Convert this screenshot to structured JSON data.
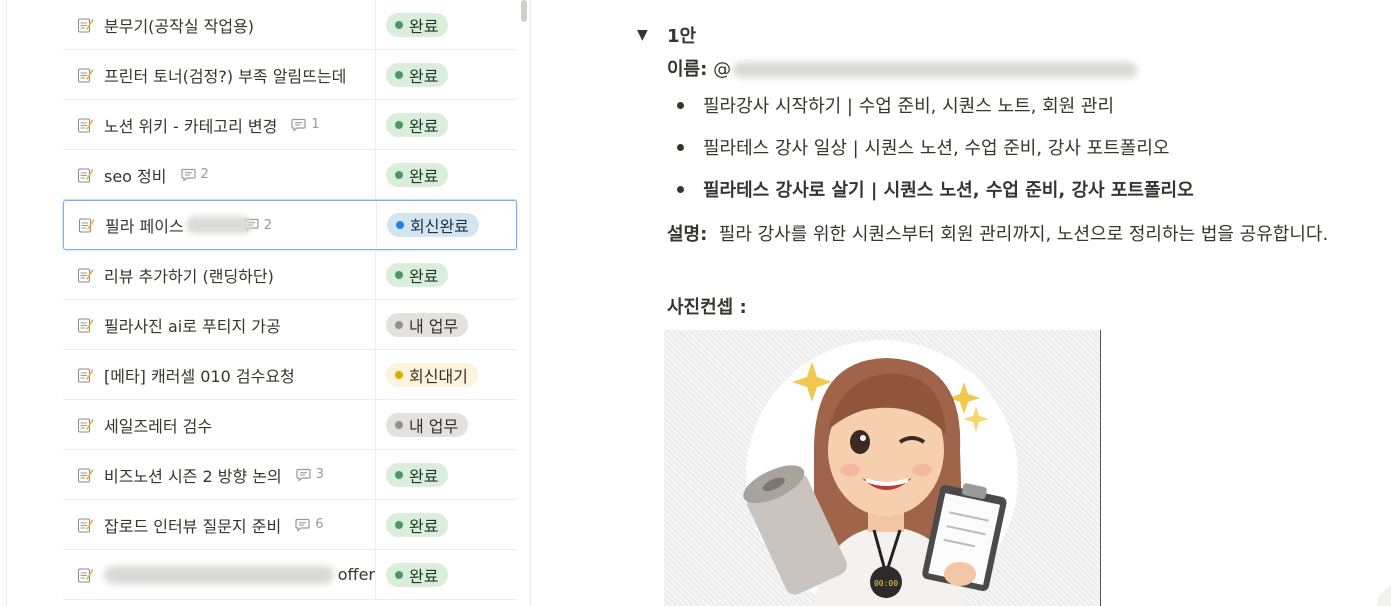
{
  "table": {
    "rows": [
      {
        "title": "분무기(공작실 작업용)",
        "comments": "",
        "status": "완료",
        "status_color": "green"
      },
      {
        "title": "프린터 토너(검정?) 부족 알림뜨는데",
        "comments": "",
        "status": "완료",
        "status_color": "green"
      },
      {
        "title": "노션 위키 - 카테고리 변경",
        "comments": "1",
        "status": "완료",
        "status_color": "green"
      },
      {
        "title": "seo 정비",
        "comments": "2",
        "status": "완료",
        "status_color": "green"
      },
      {
        "title": "필라 페이스",
        "comments": "2",
        "status": "회신완료",
        "status_color": "blue",
        "blurred_suffix": true,
        "selected": true
      },
      {
        "title": "리뷰 추가하기 (랜딩하단)",
        "comments": "",
        "status": "완료",
        "status_color": "green"
      },
      {
        "title": "필라사진 ai로 푸티지 가공",
        "comments": "",
        "status": "내 업무",
        "status_color": "gray"
      },
      {
        "title": "[메타] 캐러셀 010 검수요청",
        "comments": "",
        "status": "회신대기",
        "status_color": "yellow"
      },
      {
        "title": "세일즈레터 검수",
        "comments": "",
        "status": "내 업무",
        "status_color": "gray"
      },
      {
        "title": "비즈노션 시즌 2 방향 논의",
        "comments": "3",
        "status": "완료",
        "status_color": "green"
      },
      {
        "title": "잡로드 인터뷰 질문지 준비",
        "comments": "6",
        "status": "완료",
        "status_color": "green"
      },
      {
        "title": "offer",
        "comments": "",
        "status": "완료",
        "status_color": "green",
        "blurred_prefix": true
      }
    ],
    "title_icon": "memo-icon",
    "comment_icon": "comment-icon"
  },
  "status_colors": {
    "green": {
      "bg": "#dbeddb",
      "dot": "#4f9768",
      "text": "#1c3829"
    },
    "blue": {
      "bg": "#d3e5ef",
      "dot": "#2383e2",
      "text": "#183347"
    },
    "gray": {
      "bg": "#e3e2e0",
      "dot": "#91918e",
      "text": "#32302c"
    },
    "yellow": {
      "bg": "#fbf3db",
      "dot": "#dfab01",
      "text": "#402c1b"
    }
  },
  "doc": {
    "toggle_arrow": "▼",
    "toggle_label": "1안",
    "name_label": "이름:",
    "name_prefix": "@",
    "bullets": [
      "필라강사 시작하기  | 수업 준비, 시퀀스 노트, 회원 관리",
      "필라테스 강사 일상 | 시퀀스 노션, 수업 준비, 강사 포트폴리오",
      "필라테스 강사로 살기 | 시퀀스 노션, 수업 준비, 강사 포트폴리오"
    ],
    "desc_label": "설명:",
    "desc_text": "필라 강사를 위한 시퀀스부터 회원 관리까지, 노션으로 정리하는 법을 공유합니다.",
    "concept_label": "사진컨셉 :",
    "image_timer_text": "00:00"
  }
}
